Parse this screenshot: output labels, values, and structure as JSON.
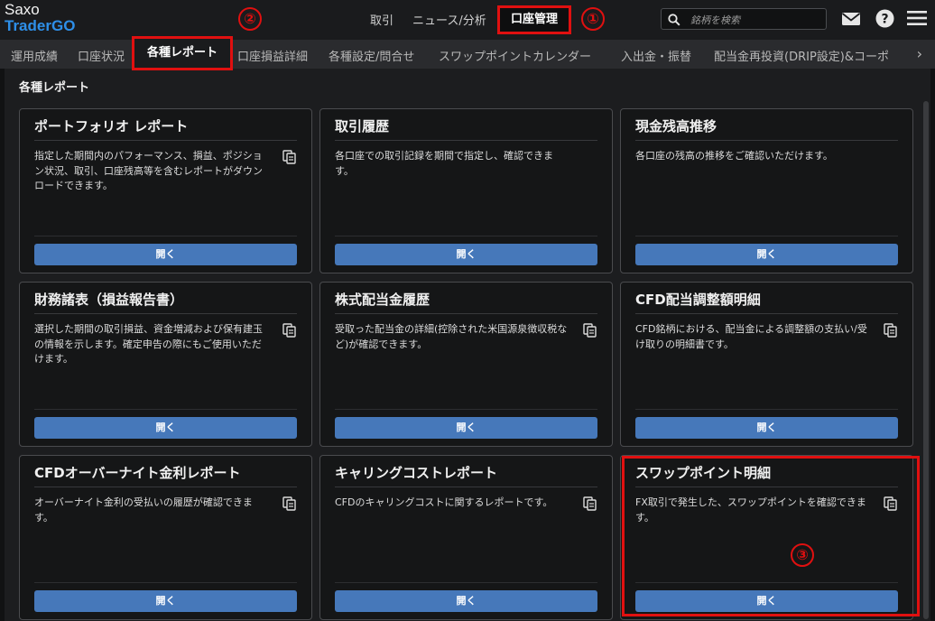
{
  "app": {
    "logo_line1": "Saxo",
    "logo_line2": "TraderGO"
  },
  "annotations": {
    "marker1": "①",
    "marker2": "②",
    "marker3": "③"
  },
  "top_nav": {
    "items": [
      "取引",
      "ニュース/分析"
    ],
    "active": "口座管理"
  },
  "search": {
    "placeholder": "銘柄を検索"
  },
  "tabs": {
    "items": [
      "運用成績",
      "口座状況",
      "口座損益詳細",
      "各種設定/問合せ",
      "スワップポイントカレンダー",
      "入出金・振替",
      "配当金再投資(DRIP設定)&コーポ"
    ],
    "active": "各種レポート"
  },
  "section": {
    "title": "各種レポート"
  },
  "cards": [
    {
      "title": "ポートフォリオ レポート",
      "desc": "指定した期間内のパフォーマンス、損益、ポジション状況、取引、口座残高等を含むレポートがダウンロードできます。",
      "button": "開く",
      "has_copy_icon": true
    },
    {
      "title": "取引履歴",
      "desc": "各口座での取引記録を期間で指定し、確認できます。",
      "button": "開く",
      "has_copy_icon": false
    },
    {
      "title": "現金残高推移",
      "desc": "各口座の残高の推移をご確認いただけます。",
      "button": "開く",
      "has_copy_icon": false
    },
    {
      "title": "財務諸表（損益報告書）",
      "desc": "選択した期間の取引損益、資金増減および保有建玉の情報を示します。確定申告の際にもご使用いただけます。",
      "button": "開く",
      "has_copy_icon": true
    },
    {
      "title": "株式配当金履歴",
      "desc": "受取った配当金の詳細(控除された米国源泉徴収税など)が確認できます。",
      "button": "開く",
      "has_copy_icon": true
    },
    {
      "title": "CFD配当調整額明細",
      "desc": "CFD銘柄における、配当金による調整額の支払い/受け取りの明細書です。",
      "button": "開く",
      "has_copy_icon": true
    },
    {
      "title": "CFDオーバーナイト金利レポート",
      "desc": "オーバーナイト金利の受払いの履歴が確認できます。",
      "button": "開く",
      "has_copy_icon": true
    },
    {
      "title": "キャリングコストレポート",
      "desc": "CFDのキャリングコストに関するレポートです。",
      "button": "開く",
      "has_copy_icon": true
    },
    {
      "title": "スワップポイント明細",
      "desc": "FX取引で発生した、スワップポイントを確認できます。",
      "button": "開く",
      "has_copy_icon": true
    }
  ],
  "icons": {
    "search": "search-icon",
    "mail": "mail-icon",
    "help": "help-icon",
    "menu": "menu-icon",
    "copy": "copy-icon",
    "chevron": "chevron-right-icon"
  },
  "colors": {
    "accent_blue": "#2e8fe8",
    "button_blue": "#4678ba",
    "highlight_red": "#e01010",
    "background": "#111213"
  }
}
